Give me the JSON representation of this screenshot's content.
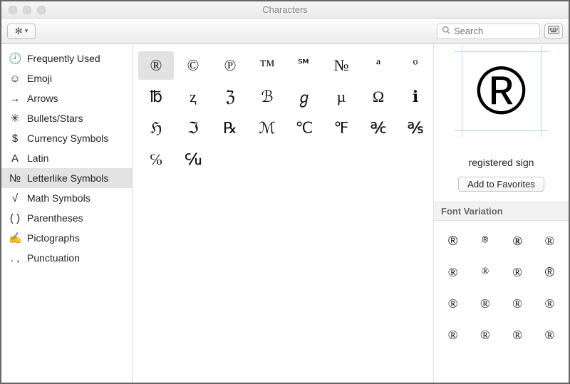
{
  "window": {
    "title": "Characters"
  },
  "toolbar": {
    "search_placeholder": "Search"
  },
  "sidebar": {
    "items": [
      {
        "icon": "🕘",
        "label": "Frequently Used"
      },
      {
        "icon": "☺",
        "label": "Emoji"
      },
      {
        "icon": "→",
        "label": "Arrows"
      },
      {
        "icon": "✳",
        "label": "Bullets/Stars"
      },
      {
        "icon": "$",
        "label": "Currency Symbols"
      },
      {
        "icon": "A",
        "label": "Latin"
      },
      {
        "icon": "№",
        "label": "Letterlike Symbols"
      },
      {
        "icon": "√",
        "label": "Math Symbols"
      },
      {
        "icon": "( )",
        "label": "Parentheses"
      },
      {
        "icon": "✍",
        "label": "Pictographs"
      },
      {
        "icon": ". ,",
        "label": "Punctuation"
      }
    ],
    "selected_index": 6
  },
  "grid": {
    "chars": [
      "®",
      "©",
      "℗",
      "™",
      "℠",
      "№",
      "ª",
      "º",
      "℔",
      "ⱬ",
      "ℨ",
      "ℬ",
      "ℊ",
      "µ",
      "Ω",
      "ℹ",
      "ℌ",
      "ℑ",
      "℞",
      "ℳ",
      "℃",
      "℉",
      "℀",
      "℁",
      "℅",
      "℆"
    ],
    "selected_index": 0
  },
  "detail": {
    "preview_char": "®",
    "name": "registered sign",
    "add_label": "Add to Favorites",
    "variation_title": "Font Variation",
    "variations": [
      "®",
      "®",
      "®",
      "®",
      "®",
      "®",
      "®",
      "®",
      "®",
      "®",
      "®",
      "®",
      "®",
      "®",
      "®",
      "®"
    ],
    "variation_fonts": [
      "Arial",
      "Courier New",
      "Arial Black",
      "Verdana",
      "Georgia",
      "Times New Roman",
      "Trebuchet MS",
      "Helvetica",
      "Palatino",
      "Tahoma",
      "Lucida Grande",
      "Gill Sans",
      "Futura",
      "Optima",
      "American Typewriter",
      "Impact"
    ]
  }
}
